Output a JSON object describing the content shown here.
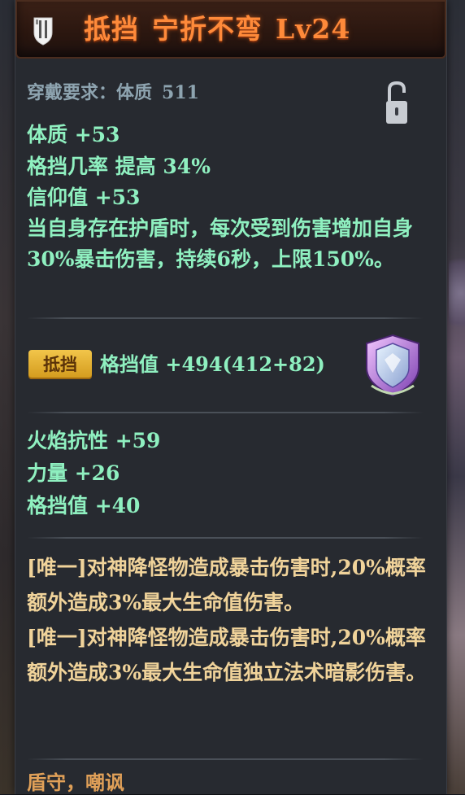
{
  "header": {
    "title_name": "抵挡",
    "title_sub": "宁折不弯",
    "title_level": "Lv24",
    "icon": "shield-icon"
  },
  "requirement": {
    "label": "穿戴要求：体质",
    "value": "511",
    "lock_icon": "lock-icon"
  },
  "base_stats": [
    "体质  +53",
    "格挡几率  提高  34%",
    "信仰值  +53"
  ],
  "special_effect": "当自身存在护盾时，每次受到伤害增加自身30%暴击伤害，持续6秒，上限150%。",
  "block": {
    "badge": "抵挡",
    "stat": "格挡值  +494(412+82)",
    "emblem_icon": "shield-emblem-icon"
  },
  "extra_stats": [
    "火焰抗性  +59",
    "力量  +26",
    "格挡值  +40"
  ],
  "unique_effects": [
    "[唯一]对神降怪物造成暴击伤害时,20%概率额外造成3%最大生命值伤害。",
    "[唯一]对神降怪物造成暴击伤害时,20%概率额外造成3%最大生命值独立法术暗影伤害。"
  ],
  "tags": "盾守，嘲讽",
  "colors": {
    "title": "#ff8a3a",
    "stat_green": "#8ff0c0",
    "effect_gold": "#f0d39a",
    "tag_orange": "#e0a058",
    "requirement": "#8ea4b0"
  }
}
